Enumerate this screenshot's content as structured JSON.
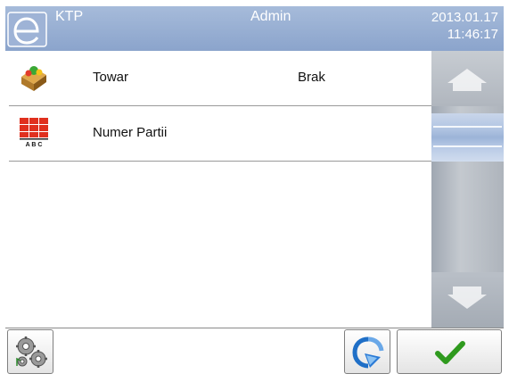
{
  "header": {
    "title": "KTP",
    "user": "Admin",
    "date": "2013.01.17",
    "time": "11:46:17",
    "logo_icon": "e-logo-icon"
  },
  "list": {
    "items": [
      {
        "label": "Towar",
        "value": "Brak",
        "icon": "product-box-icon"
      },
      {
        "label": "Numer Partii",
        "value": "",
        "icon": "batch-number-icon",
        "icon_text": "A B C"
      }
    ]
  },
  "scrollbar": {
    "up_icon": "arrow-up-icon",
    "down_icon": "arrow-down-icon"
  },
  "footer": {
    "settings_icon": "settings-gears-icon",
    "restore_icon": "restore-icon",
    "ok_icon": "checkmark-icon"
  },
  "colors": {
    "header_bg": "#8ba4cc",
    "scroll_thumb": "#b3c6e3",
    "ok_check": "#2f9a1e"
  }
}
